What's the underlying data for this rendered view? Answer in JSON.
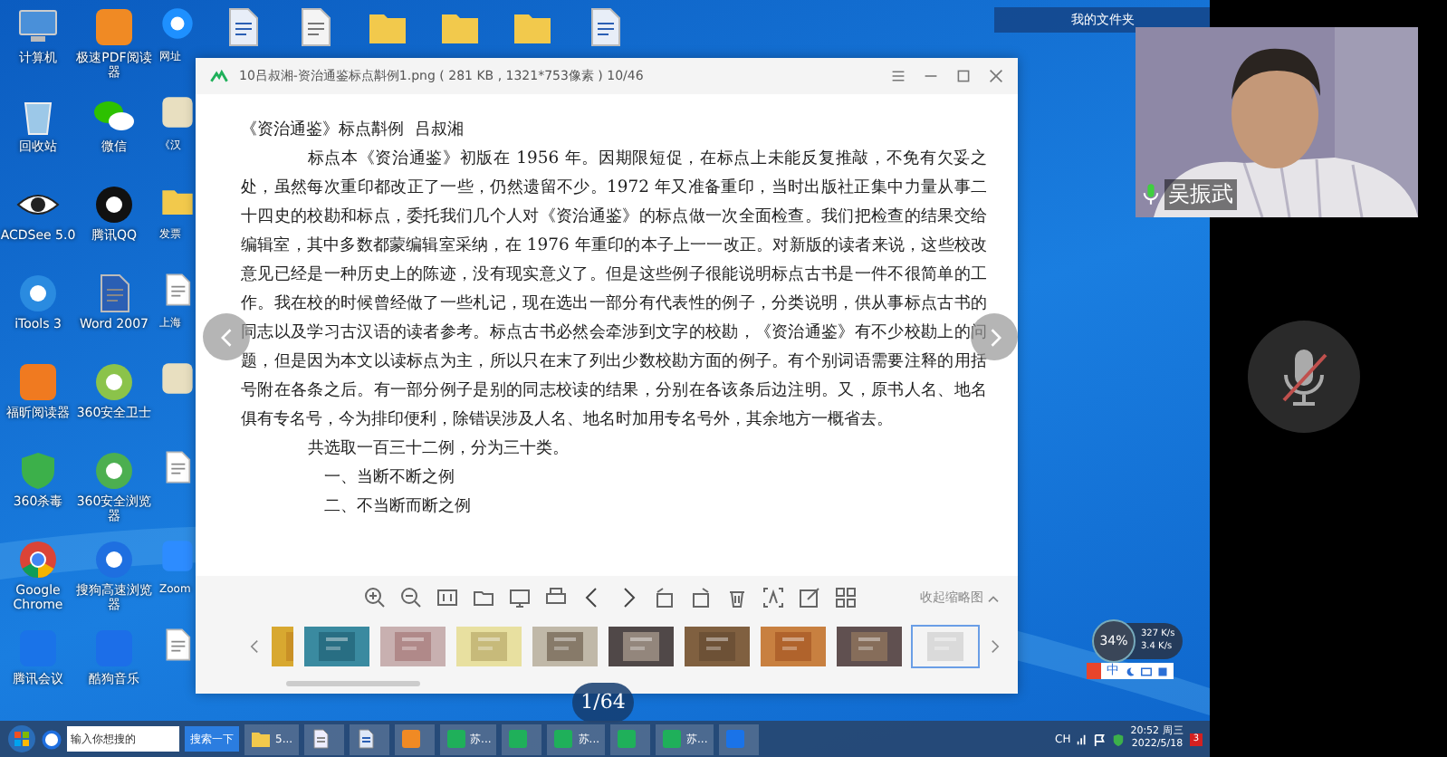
{
  "desktop": {
    "icon_columns": [
      [
        {
          "label": "计算机",
          "kind": "computer"
        },
        {
          "label": "回收站",
          "kind": "recycle"
        },
        {
          "label": "ACDSee 5.0",
          "kind": "eye"
        },
        {
          "label": "iTools 3",
          "kind": "itools"
        },
        {
          "label": "福昕阅读器",
          "kind": "foxit"
        },
        {
          "label": "360杀毒",
          "kind": "shield"
        },
        {
          "label": "Google Chrome",
          "kind": "chrome"
        },
        {
          "label": "腾讯会议",
          "kind": "meeting"
        }
      ],
      [
        {
          "label": "极速PDF阅读器",
          "kind": "pdf"
        },
        {
          "label": "微信",
          "kind": "wechat"
        },
        {
          "label": "腾讯QQ",
          "kind": "qq"
        },
        {
          "label": "Word 2007",
          "kind": "word"
        },
        {
          "label": "360安全卫士",
          "kind": "s360"
        },
        {
          "label": "360安全浏览器",
          "kind": "browser"
        },
        {
          "label": "搜狗高速浏览器",
          "kind": "sogou"
        },
        {
          "label": "酷狗音乐",
          "kind": "kugou"
        }
      ],
      [
        {
          "label": "网址",
          "kind": "ie"
        },
        {
          "label": "《汉",
          "kind": "book"
        },
        {
          "label": "发票",
          "kind": "folder"
        },
        {
          "label": "上海",
          "kind": "doc"
        },
        {
          "kind": "book"
        },
        {
          "kind": "doc"
        },
        {
          "label": "Zoom",
          "kind": "zoom"
        },
        {
          "kind": "doc"
        }
      ]
    ],
    "top_row_icons": [
      {
        "kind": "word"
      },
      {
        "kind": "doc"
      },
      {
        "kind": "folder"
      },
      {
        "kind": "folder"
      },
      {
        "kind": "folder"
      },
      {
        "kind": "word"
      }
    ],
    "folder_bar": "我的文件夹"
  },
  "viewer": {
    "title": "10吕叔湘-资治通鉴标点斠例1.png ( 281 KB , 1321*753像素 ) 10/46",
    "document": {
      "heading": "《资治通鉴》标点斠例  吕叔湘",
      "paragraph": "标点本《资治通鉴》初版在 1956 年。因期限短促，在标点上未能反复推敲，不免有欠妥之处，虽然每次重印都改正了一些，仍然遗留不少。1972 年又准备重印，当时出版社正集中力量从事二十四史的校勘和标点，委托我们几个人对《资治通鉴》的标点做一次全面检查。我们把检查的结果交给编辑室，其中多数都蒙编辑室采纳，在 1976 年重印的本子上一一改正。对新版的读者来说，这些校改意见已经是一种历史上的陈迹，没有现实意义了。但是这些例子很能说明标点古书是一件不很简单的工作。我在校的时候曾经做了一些札记，现在选出一部分有代表性的例子，分类说明，供从事标点古书的同志以及学习古汉语的读者参考。标点古书必然会牵涉到文字的校勘，《资治通鉴》有不少校勘上的问题，但是因为本文以读标点为主，所以只在末了列出少数校勘方面的例子。有个别词语需要注释的用括号附在各条之后。有一部分例子是别的同志校读的结果，分别在各该条后边注明。又，原书人名、地名俱有专名号，今为排印便利，除错误涉及人名、地名时加用专名号外，其余地方一概省去。",
      "summary": "共选取一百三十二例，分为三十类。",
      "items": [
        "一、当断不断之例",
        "二、不当断而断之例"
      ]
    },
    "collapse_thumbnails": "收起缩略图",
    "thumbnails": [
      {
        "selected": false
      },
      {
        "selected": false
      },
      {
        "selected": false
      },
      {
        "selected": false
      },
      {
        "selected": false
      },
      {
        "selected": false
      },
      {
        "selected": false
      },
      {
        "selected": false
      },
      {
        "selected": false
      },
      {
        "selected": true
      }
    ],
    "page_counter": "1/64"
  },
  "video": {
    "name": "吴振武",
    "mic_on": true
  },
  "self_tile": {
    "muted": true
  },
  "speed_widget": {
    "percent": "34%",
    "upload": "327 K/s",
    "download": "3.4 K/s"
  },
  "ime_bar": {
    "mode": "中"
  },
  "taskbar": {
    "search": {
      "placeholder": "输入你想搜的",
      "button": "搜索一下"
    },
    "tasks": [
      {
        "kind": "folder",
        "label": "5..."
      },
      {
        "kind": "doc"
      },
      {
        "kind": "word"
      },
      {
        "kind": "pdf"
      },
      {
        "kind": "app",
        "label": "苏..."
      },
      {
        "kind": "app"
      },
      {
        "kind": "app",
        "label": "苏..."
      },
      {
        "kind": "app"
      },
      {
        "kind": "app",
        "label": "苏..."
      },
      {
        "kind": "meeting"
      }
    ],
    "tray": {
      "language": "CH",
      "time": "20:52 周三",
      "date": "2022/5/18",
      "notifications": "3"
    }
  }
}
